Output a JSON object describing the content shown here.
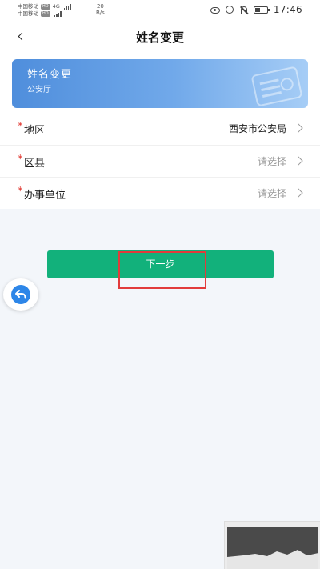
{
  "status_bar": {
    "carrier_1": "中国移动",
    "carrier_1_tag": "HD",
    "carrier_2": "中国移动",
    "carrier_2_tag": "HD",
    "network": "4G",
    "speed_value": "20",
    "speed_unit": "B/s",
    "battery_level_percent": 45,
    "time": "17:46"
  },
  "nav": {
    "title": "姓名变更"
  },
  "banner": {
    "title": "姓名变更",
    "subtitle": "公安厅",
    "gradient_colors": [
      "#4f8edc",
      "#a6cdf6"
    ]
  },
  "form": {
    "rows": [
      {
        "label": "地区",
        "value": "西安市公安局",
        "is_placeholder": false
      },
      {
        "label": "区县",
        "value": "请选择",
        "is_placeholder": true
      },
      {
        "label": "办事单位",
        "value": "请选择",
        "is_placeholder": true
      }
    ],
    "required_mark": "*"
  },
  "actions": {
    "next_label": "下一步",
    "next_color": "#12b17b",
    "highlight_color": "#e23b3b"
  },
  "float_button": {
    "icon": "return-arrow-icon",
    "color": "#2d86e8"
  }
}
